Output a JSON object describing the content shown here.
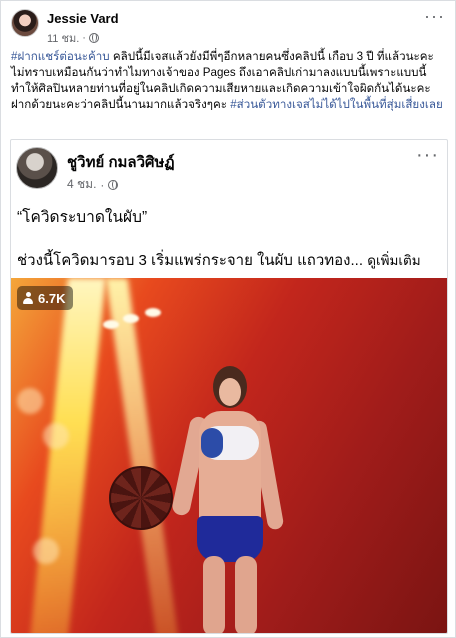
{
  "post": {
    "author": "Jessie Vard",
    "time": "11 ชม.",
    "dot": "·",
    "caption_hashtag": "#ฝากแชร์ต่อนะค้าบ",
    "caption_text": " คลิปนี้มีเจสแล้วยังมีพี่ๆอีกหลายคนซึ่งคลิปนี้ เกือบ 3 ปี ที่แล้วนะคะไม่ทราบเหมือนกันว่าทำไมทางเจ้าของ Pages ถึงเอาคลิปเก่ามาลงแบบนี้เพราะแบบนี้ทำให้ศิลปินหลายท่านที่อยู่ในคลิปเกิดความเสียหายและเกิดความเข้าใจผิดกันได้นะคะฝากด้วยนะคะว่าคลิปนี้นานมากแล้วจริงๆคะ ",
    "caption_hashtag2": "#ส่วนตัวทางเจสไม่ได้ไปในพื้นที่สุ่มเสี่ยงเลย",
    "more": "···"
  },
  "shared": {
    "author": "ชูวิทย์ กมลวิศิษฏ์",
    "time": "4 ชม.",
    "dot": "·",
    "title": "“โควิดระบาดในผับ”",
    "body": "ช่วงนี้โควิดมารอบ 3 เริ่มแพร่กระจาย ในผับ แถวทอง...",
    "see_more": "ดูเพิ่มเติม",
    "more": "···"
  },
  "video": {
    "views": "6.7K"
  },
  "icons": {
    "globe": "globe-icon",
    "person": "person-icon",
    "more": "more-options-icon"
  },
  "colors": {
    "hashtag": "#385898",
    "secondary_text": "#65676b"
  }
}
